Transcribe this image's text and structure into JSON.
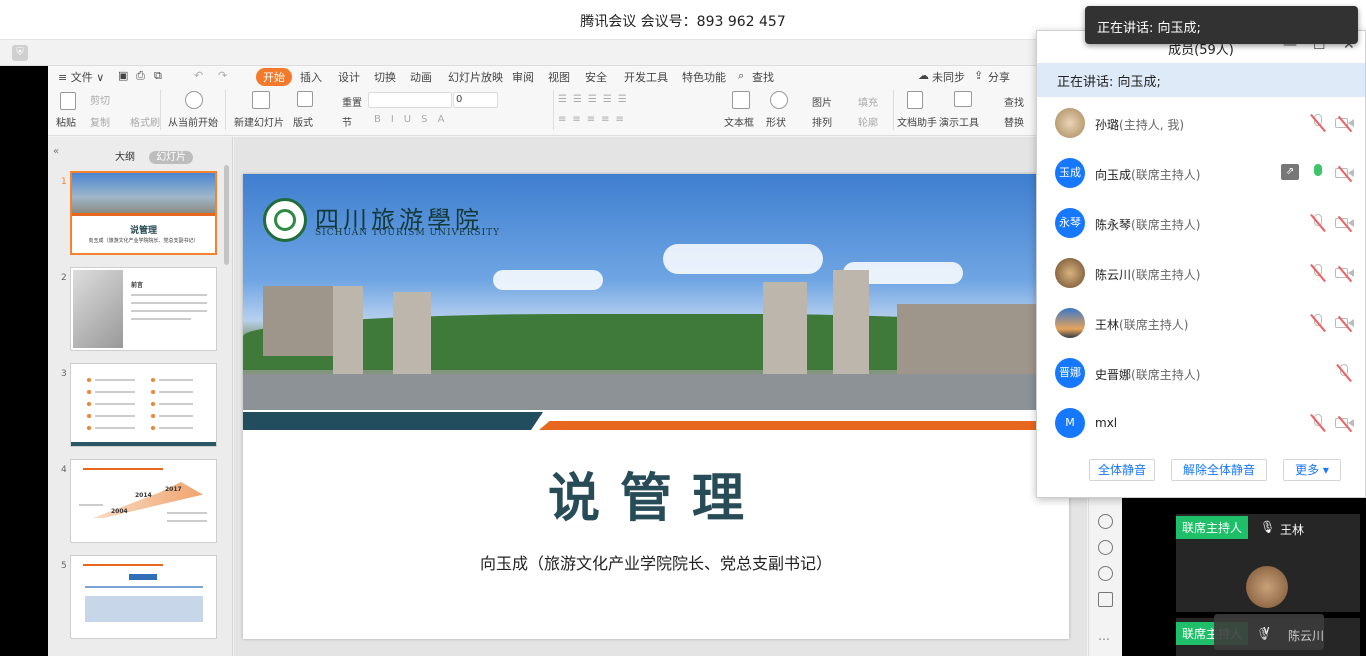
{
  "window": {
    "title": "腾讯会议 会议号：893 962 457"
  },
  "menu": {
    "file": "≡ 文件 ∨",
    "tabs": [
      "开始",
      "插入",
      "设计",
      "切换",
      "动画",
      "幻灯片放映",
      "审阅",
      "视图",
      "安全",
      "开发工具",
      "特色功能"
    ],
    "search": "查找",
    "sync": "未同步",
    "share": "分享"
  },
  "ribbon": {
    "paste": "粘贴",
    "cut": "剪切",
    "copy": "复制",
    "format_painter": "格式刷",
    "from_current": "从当前开始",
    "new_slide": "新建幻灯片",
    "layout": "版式",
    "section": "节",
    "reset": "重置",
    "font_size": "0",
    "textbox": "文本框",
    "shape": "形状",
    "picture": "图片",
    "arrange": "排列",
    "fill": "填充",
    "outline": "轮廓",
    "doc_helper": "文档助手",
    "present_tools": "演示工具",
    "find": "查找",
    "replace": "替换"
  },
  "sidepane": {
    "tab_outline": "大纲",
    "tab_slides": "幻灯片",
    "slide_numbers": [
      "1",
      "2",
      "3",
      "4",
      "5"
    ],
    "thumb1": {
      "title": "说管理",
      "sub": "向玉成（旅游文化产业学院院长、党总支副书记）"
    },
    "thumb2": {
      "title": "前言"
    },
    "thumb4": {
      "years": [
        "2004",
        "2014",
        "2017"
      ]
    }
  },
  "slide": {
    "school_cn": "四川旅游學院",
    "school_en": "SICHUAN TOURISM UNIVERSITY",
    "title": "说管理",
    "subtitle": "向玉成（旅游文化产业学院院长、党总支副书记）"
  },
  "toast": {
    "text": "正在讲话: 向玉成;"
  },
  "members_panel": {
    "title": "成员(59人)",
    "speaking": "正在讲话: 向玉成;",
    "members": [
      {
        "name": "孙璐",
        "role": "(主持人, 我)",
        "avatar": "",
        "mic": "muted",
        "cam": "off"
      },
      {
        "name": "向玉成",
        "role": "(联席主持人)",
        "avatar": "玉成",
        "mic": "on",
        "cam": "off",
        "sharing": true
      },
      {
        "name": "陈永琴",
        "role": "(联席主持人)",
        "avatar": "永琴",
        "mic": "muted",
        "cam": "off"
      },
      {
        "name": "陈云川",
        "role": "(联席主持人)",
        "avatar": "",
        "mic": "muted",
        "cam": "off"
      },
      {
        "name": "王林",
        "role": "(联席主持人)",
        "avatar": "",
        "mic": "muted",
        "cam": "off"
      },
      {
        "name": "史晋娜",
        "role": "(联席主持人)",
        "avatar": "晋娜",
        "mic": "muted",
        "cam": "none"
      },
      {
        "name": "mxl",
        "role": "",
        "avatar": "M",
        "mic": "muted",
        "cam": "off"
      }
    ],
    "mute_all": "全体静音",
    "unmute_all": "解除全体静音",
    "more": "更多 ▾"
  },
  "video_tiles": [
    {
      "badge": "联席主持人",
      "name": "王林"
    },
    {
      "badge": "联席主持人",
      "name": "陈云川"
    }
  ],
  "colors": {
    "accent": "#f5792a",
    "meeting_blue": "#1677ff",
    "title_teal": "#284b58",
    "band_orange": "#e8671e"
  }
}
